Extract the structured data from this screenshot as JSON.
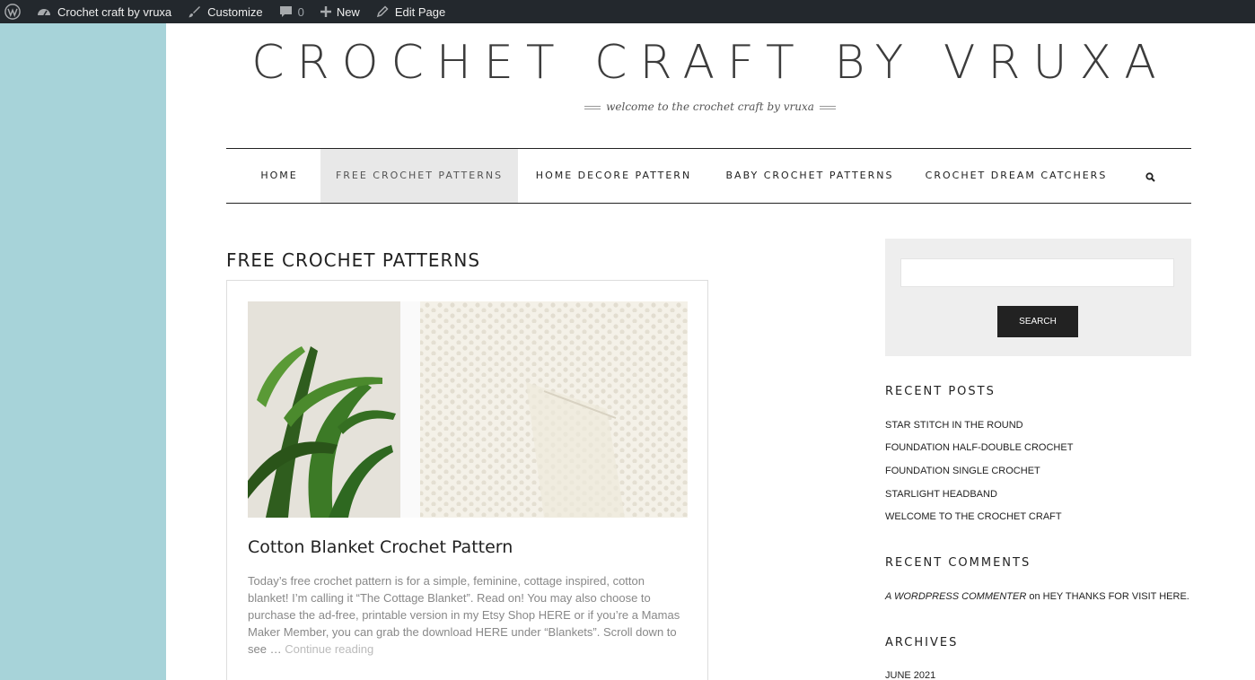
{
  "adminbar": {
    "site_name": "Crochet craft by vruxa",
    "customize": "Customize",
    "comments_count": "0",
    "new": "New",
    "edit_page": "Edit Page"
  },
  "header": {
    "title": "CROCHET CRAFT BY VRUXA",
    "tagline": "welcome to the crochet craft by vruxa"
  },
  "nav": {
    "items": [
      "HOME",
      "FREE CROCHET PATTERNS",
      "HOME DECORE PATTERN",
      "BABY CROCHET PATTERNS",
      "CROCHET DREAM CATCHERS"
    ],
    "active_index": 1
  },
  "main": {
    "archive_title": "FREE CROCHET PATTERNS",
    "post": {
      "title": "Cotton Blanket Crochet Pattern",
      "excerpt": "Today’s free crochet pattern is for a simple, feminine, cottage inspired, cotton blanket! I’m calling it “The Cottage Blanket”. Read on! You may also choose to purchase the ad-free, printable version in my Etsy Shop HERE or if you’re a Mamas Maker Member, you can grab the download HERE under “Blankets”. Scroll down to see …",
      "more": "Continue reading"
    }
  },
  "sidebar": {
    "search": {
      "value": "",
      "button": "SEARCH"
    },
    "recent_posts": {
      "title": "RECENT POSTS",
      "items": [
        "STAR STITCH IN THE ROUND",
        "FOUNDATION HALF-DOUBLE CROCHET",
        "FOUNDATION SINGLE CROCHET",
        "STARLIGHT HEADBAND",
        "WELCOME TO THE CROCHET CRAFT"
      ]
    },
    "recent_comments": {
      "title": "RECENT COMMENTS",
      "author": "A WORDPRESS COMMENTER",
      "on": "on",
      "post": "HEY THANKS FOR VISIT HERE."
    },
    "archives": {
      "title": "ARCHIVES",
      "items": [
        "JUNE 2021"
      ]
    }
  },
  "colors": {
    "background": "#a7d3d9",
    "adminbar": "#23282d",
    "nav_active": "#e8e8e8",
    "button": "#222222"
  }
}
